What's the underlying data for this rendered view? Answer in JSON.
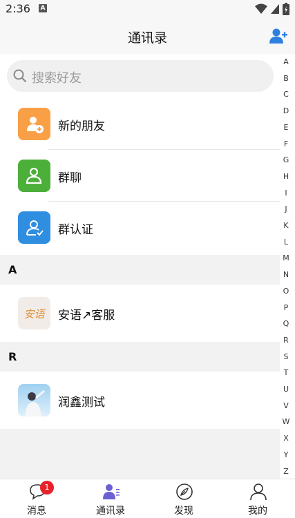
{
  "status_bar": {
    "time": "2:36",
    "notification_glyph": "A"
  },
  "header": {
    "title": "通讯录",
    "add_friend_icon": "add-person-icon"
  },
  "search": {
    "placeholder": "搜索好友"
  },
  "menu": [
    {
      "label": "新的朋友",
      "icon": "new-friend-icon",
      "color": "#f9a046"
    },
    {
      "label": "群聊",
      "icon": "group-chat-icon",
      "color": "#4caf3a"
    },
    {
      "label": "群认证",
      "icon": "group-verify-icon",
      "color": "#2f8ee0"
    }
  ],
  "sections": [
    {
      "letter": "A",
      "contacts": [
        {
          "name": "安语↗客服",
          "avatar_text": "安语"
        }
      ]
    },
    {
      "letter": "R",
      "contacts": [
        {
          "name": "润鑫测试"
        }
      ]
    }
  ],
  "index_letters": [
    "A",
    "B",
    "C",
    "D",
    "E",
    "F",
    "G",
    "H",
    "I",
    "J",
    "K",
    "L",
    "M",
    "N",
    "O",
    "P",
    "Q",
    "R",
    "S",
    "T",
    "U",
    "V",
    "W",
    "X",
    "Y",
    "Z"
  ],
  "tabs": [
    {
      "label": "消息",
      "icon": "message-icon",
      "badge": "1"
    },
    {
      "label": "通讯录",
      "icon": "contacts-icon",
      "active": true
    },
    {
      "label": "发现",
      "icon": "discover-icon"
    },
    {
      "label": "我的",
      "icon": "profile-icon"
    }
  ],
  "colors": {
    "accent": "#6b5fd3",
    "badge": "#e8222a"
  }
}
